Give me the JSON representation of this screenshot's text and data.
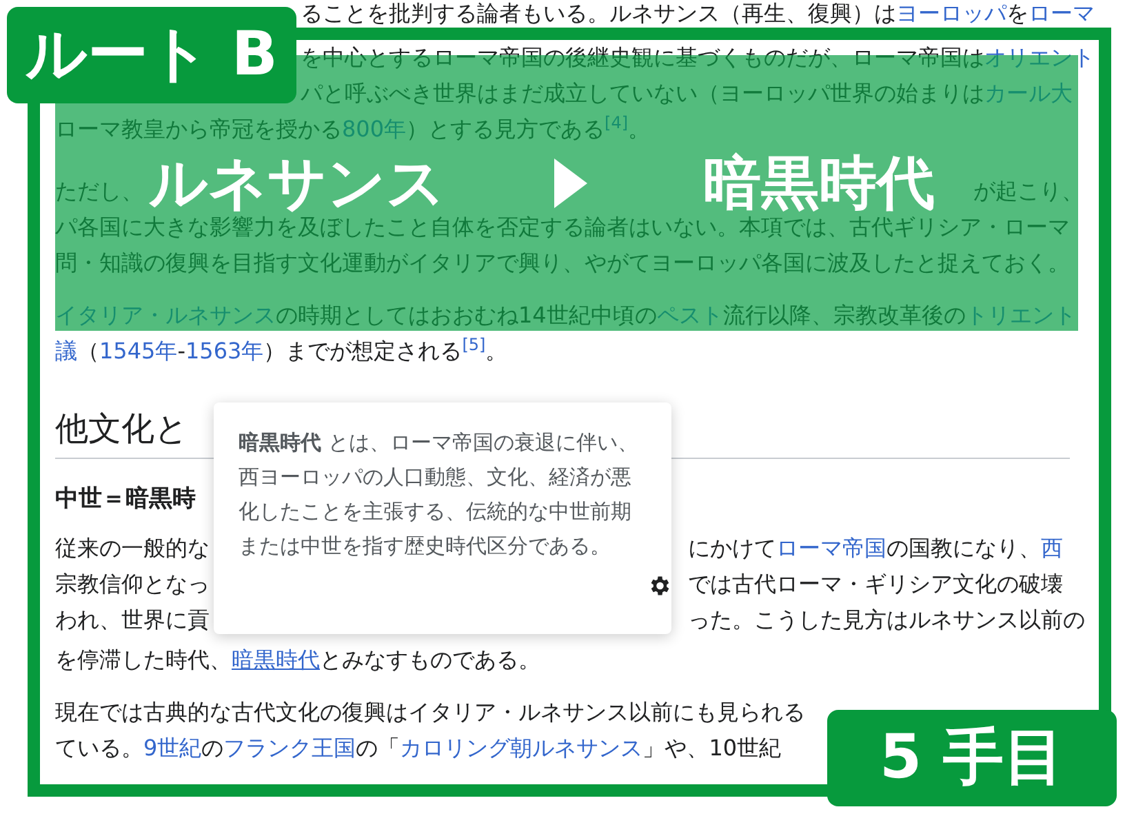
{
  "article": {
    "blocks": [
      {
        "kind": "paragraph",
        "lines": [
          {
            "kind": "clipped_start",
            "parts": [
              [
                {
                  "kind": "plain",
                  "text": "ることを批判する論者もいる。ルネサンス（再生、復興）は"
                },
                {
                  "kind": "link",
                  "text": "ヨーロッパ"
                },
                {
                  "kind": "plain",
                  "text": "を"
                },
                {
                  "kind": "link",
                  "text": "ローマ"
                }
              ]
            ]
          },
          {
            "kind": "clipped_start",
            "parts": [
              [
                {
                  "kind": "plain",
                  "text": "を中心とするローマ帝国の後継史観に基づくものだが、ローマ帝国は"
                },
                {
                  "kind": "link",
                  "text": "オリエント"
                }
              ]
            ]
          },
          {
            "kind": "clipped_start",
            "parts": [
              [
                {
                  "kind": "plain",
                  "text": "パと呼ぶべき世界はまだ成立していない（ヨーロッパ世界の始まりは"
                },
                {
                  "kind": "link",
                  "text": "カール大"
                }
              ]
            ]
          },
          {
            "kind": "full",
            "parts": [
              [
                {
                  "kind": "plain",
                  "text": "ローマ教皇から帝冠を授かる"
                },
                {
                  "kind": "link",
                  "text": "800年"
                },
                {
                  "kind": "plain",
                  "text": "）とする見方である"
                },
                {
                  "kind": "ref",
                  "text": "[4]"
                },
                {
                  "kind": "plain",
                  "text": "。"
                }
              ]
            ]
          }
        ]
      },
      {
        "kind": "paragraph",
        "lines": [
          {
            "kind": "spread",
            "parts": [
              [
                {
                  "kind": "plain",
                  "text": "ただし、"
                }
              ],
              [
                {
                  "kind": "plain",
                  "text": "が起こり、"
                }
              ]
            ]
          },
          {
            "kind": "full",
            "parts": [
              [
                {
                  "kind": "plain",
                  "text": "パ各国に大きな影響力を及ぼしたこと自体を否定する論者はいない。本項では、古代ギリシア・ローマ"
                }
              ]
            ]
          },
          {
            "kind": "full",
            "parts": [
              [
                {
                  "kind": "plain",
                  "text": "問・知識の復興を目指す文化運動がイタリアで興り、やがてヨーロッパ各国に波及したと捉えておく。"
                }
              ]
            ]
          }
        ]
      },
      {
        "kind": "paragraph",
        "lines": [
          {
            "kind": "full",
            "parts": [
              [
                {
                  "kind": "link",
                  "text": "イタリア・ルネサンス"
                },
                {
                  "kind": "plain",
                  "text": "の時期としてはおおむね14世紀中頃の"
                },
                {
                  "kind": "link",
                  "text": "ペスト"
                },
                {
                  "kind": "plain",
                  "text": "流行以降、宗教改革後の"
                },
                {
                  "kind": "link",
                  "text": "トリエント"
                }
              ]
            ]
          },
          {
            "kind": "full",
            "parts": [
              [
                {
                  "kind": "link",
                  "text": "議"
                },
                {
                  "kind": "plain",
                  "text": "（"
                },
                {
                  "kind": "link",
                  "text": "1545年"
                },
                {
                  "kind": "plain",
                  "text": "-"
                },
                {
                  "kind": "link",
                  "text": "1563年"
                },
                {
                  "kind": "plain",
                  "text": "）までが想定される"
                },
                {
                  "kind": "ref",
                  "text": "[5]"
                },
                {
                  "kind": "plain",
                  "text": "。"
                }
              ]
            ]
          }
        ]
      },
      {
        "kind": "heading",
        "text": "他文化と"
      },
      {
        "kind": "subheading",
        "text": "中世＝暗黒時"
      },
      {
        "kind": "paragraph",
        "lines": [
          {
            "kind": "split",
            "parts": [
              [
                {
                  "kind": "plain",
                  "text": "従来の一般的な"
                }
              ],
              [
                {
                  "kind": "plain",
                  "text": "にかけて"
                },
                {
                  "kind": "link",
                  "text": "ローマ帝国"
                },
                {
                  "kind": "plain",
                  "text": "の国教になり、"
                },
                {
                  "kind": "link",
                  "text": "西"
                }
              ]
            ]
          },
          {
            "kind": "split",
            "parts": [
              [
                {
                  "kind": "plain",
                  "text": "宗教信仰となっ"
                }
              ],
              [
                {
                  "kind": "plain",
                  "text": "では古代ローマ・ギリシア文化の破壊"
                }
              ]
            ]
          },
          {
            "kind": "split",
            "parts": [
              [
                {
                  "kind": "plain",
                  "text": "われ、世界に貢"
                }
              ],
              [
                {
                  "kind": "plain",
                  "text": "った。こうした見方はルネサンス以前の"
                }
              ]
            ]
          },
          {
            "kind": "full",
            "parts": [
              [
                {
                  "kind": "plain",
                  "text": "を停滞した時代、"
                },
                {
                  "kind": "hovered_link",
                  "text": "暗黒時代"
                },
                {
                  "kind": "plain",
                  "text": "とみなすものである。"
                }
              ]
            ]
          }
        ]
      },
      {
        "kind": "paragraph",
        "lines": [
          {
            "kind": "full",
            "parts": [
              [
                {
                  "kind": "plain",
                  "text": "現在では古典的な古代文化の復興はイタリア・ルネサンス以前にも見られる"
                }
              ]
            ]
          },
          {
            "kind": "full",
            "parts": [
              [
                {
                  "kind": "plain",
                  "text": "ている。"
                },
                {
                  "kind": "link",
                  "text": "9世紀"
                },
                {
                  "kind": "plain",
                  "text": "の"
                },
                {
                  "kind": "link",
                  "text": "フランク王国"
                },
                {
                  "kind": "plain",
                  "text": "の「"
                },
                {
                  "kind": "link",
                  "text": "カロリング朝ルネサンス"
                },
                {
                  "kind": "plain",
                  "text": "」や、10世紀"
                }
              ]
            ]
          }
        ]
      }
    ]
  },
  "popup": {
    "text": "**暗黒時代** とは、ローマ帝国の衰退に伴い、西ヨーロッパの人口動態、文化、経済が悪化したことを主張する、伝統的な中世前期または中世を指す歴史時代区分である。"
  },
  "overlay": {
    "route": "ルート B",
    "from": "ルネサンス",
    "to": "暗黒時代",
    "step": "5 手目"
  }
}
